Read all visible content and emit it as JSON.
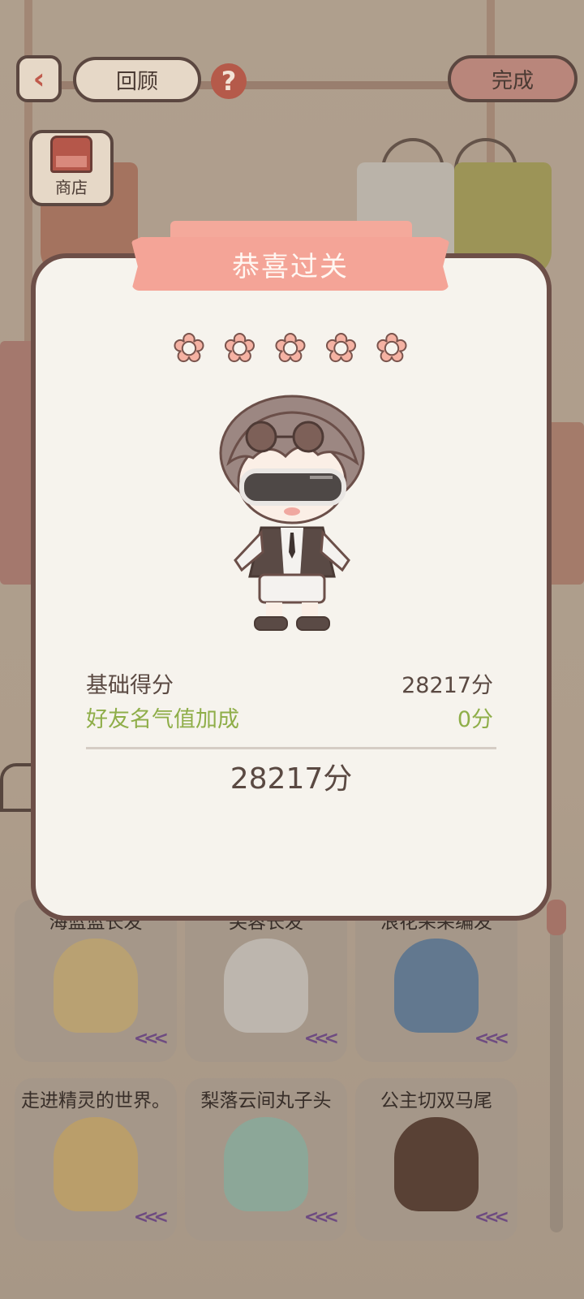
{
  "header": {
    "back_label": "‹",
    "review_label": "回顾",
    "help_label": "?",
    "done_label": "完成"
  },
  "shop": {
    "label": "商店"
  },
  "modal": {
    "banner_title": "恭喜过关",
    "stars": 5,
    "base_score_label": "基础得分",
    "base_score_value": "28217分",
    "bonus_label": "好友名气值加成",
    "bonus_value": "0分",
    "total": "28217分"
  },
  "items": [
    {
      "title": "海蓝蓝长发",
      "hair_color": "#e7c98a"
    },
    {
      "title": "芙蓉长发",
      "hair_color": "#ece7e0"
    },
    {
      "title": "浪花朵朵编发",
      "hair_color": "#6b8fb4"
    },
    {
      "title": "走进精灵的世界。",
      "hair_color": "#e9c47f"
    },
    {
      "title": "梨落云间丸子头",
      "hair_color": "#a6d2c1"
    },
    {
      "title": "公主切双马尾",
      "hair_color": "#5e3f33"
    }
  ],
  "colors": {
    "accent": "#f4a497",
    "border": "#6d4f48",
    "bonus_text": "#8fae49"
  }
}
